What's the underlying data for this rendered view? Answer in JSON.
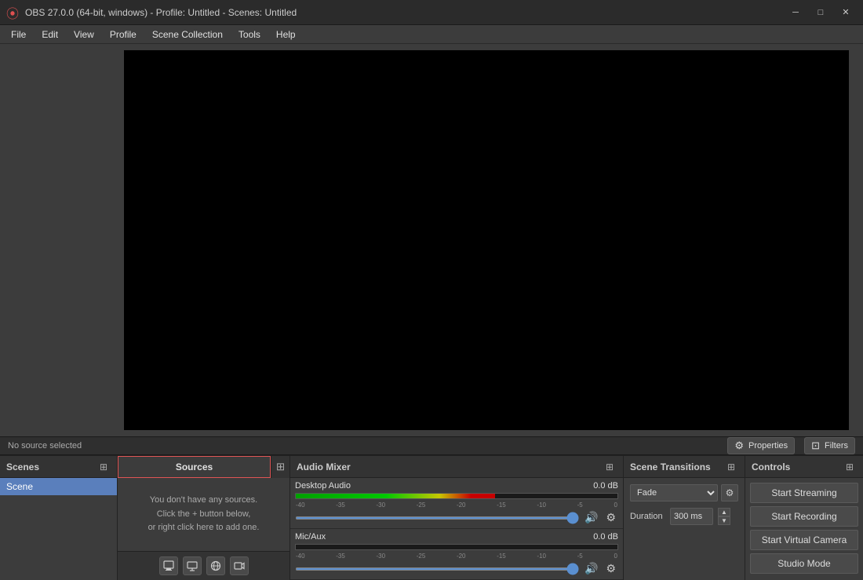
{
  "titleBar": {
    "icon": "⦿",
    "title": "OBS 27.0.0 (64-bit, windows) - Profile: Untitled - Scenes: Untitled",
    "minimize": "─",
    "maximize": "□",
    "close": "✕"
  },
  "menuBar": {
    "items": [
      "File",
      "Edit",
      "View",
      "Profile",
      "Scene Collection",
      "Tools",
      "Help"
    ]
  },
  "statusBar": {
    "noSource": "No source selected",
    "propertiesBtn": "⚙ Properties",
    "filtersBtn": "⊡ Filters"
  },
  "scenesPanel": {
    "header": "Scenes",
    "expandIcon": "⊞",
    "items": [
      "Scene"
    ]
  },
  "sourcesPanel": {
    "header": "Sources",
    "expandIcon": "⊞",
    "emptyText": "You don't have any sources.\nClick the + button below,\nor right click here to add one.",
    "icons": [
      "🖼",
      "🖥",
      "🌐",
      "📷"
    ]
  },
  "audioMixer": {
    "header": "Audio Mixer",
    "expandIcon": "⊞",
    "channels": [
      {
        "name": "Desktop Audio",
        "db": "0.0 dB",
        "meterWidth": "62%"
      },
      {
        "name": "Mic/Aux",
        "db": "0.0 dB",
        "meterWidth": "0%"
      }
    ],
    "ticks": [
      "-40",
      "-35",
      "-30",
      "-25",
      "-20",
      "-15",
      "-10",
      "-5",
      "0"
    ]
  },
  "sceneTransitions": {
    "header": "Scene Transitions",
    "expandIcon": "⊞",
    "fadeValue": "Fade",
    "durationLabel": "Duration",
    "durationValue": "300 ms"
  },
  "controls": {
    "header": "Controls",
    "expandIcon": "⊞",
    "buttons": [
      "Start Streaming",
      "Start Recording",
      "Start Virtual Camera",
      "Studio Mode"
    ]
  },
  "colors": {
    "bg": "#3c3c3c",
    "panelHeader": "#333333",
    "preview": "#000000",
    "accent": "#5a7fbc",
    "meterGreen": "#00c800",
    "border": "#222222"
  }
}
